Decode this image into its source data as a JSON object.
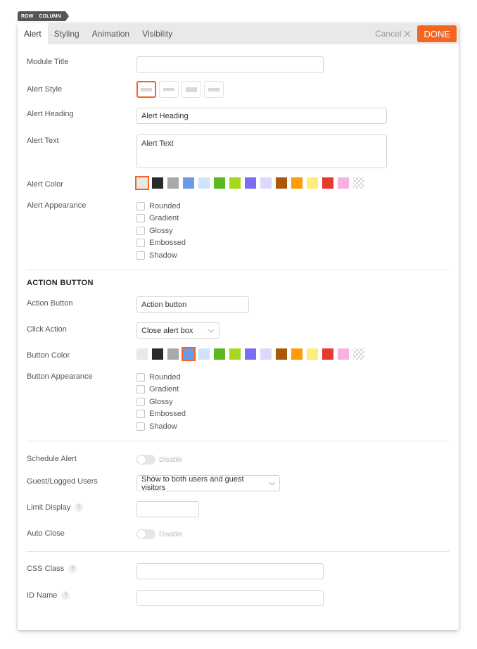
{
  "breadcrumb": [
    "ROW",
    "COLUMN"
  ],
  "tabs": [
    {
      "label": "Alert",
      "active": true
    },
    {
      "label": "Styling",
      "active": false
    },
    {
      "label": "Animation",
      "active": false
    },
    {
      "label": "Visibility",
      "active": false
    }
  ],
  "actions": {
    "cancel_label": "Cancel",
    "done_label": "DONE",
    "accent": "#f26522"
  },
  "alert": {
    "module_title": {
      "label": "Module Title",
      "value": ""
    },
    "alert_style": {
      "label": "Alert Style",
      "options": [
        "style-1",
        "style-2",
        "style-3",
        "style-4"
      ],
      "selected_index": 0
    },
    "alert_heading": {
      "label": "Alert Heading",
      "value": "Alert Heading"
    },
    "alert_text": {
      "label": "Alert Text",
      "value": "Alert Text"
    },
    "alert_color": {
      "label": "Alert Color",
      "selected_index": 0
    },
    "alert_appearance": {
      "label": "Alert Appearance",
      "options": [
        "Rounded",
        "Gradient",
        "Glossy",
        "Embossed",
        "Shadow"
      ]
    }
  },
  "colors": [
    "#e8e8e8",
    "#2a2a2a",
    "#a9a9a9",
    "#6a9be8",
    "#cfe3fb",
    "#5bb81f",
    "#a6d81c",
    "#7b6ef2",
    "#dcd9fb",
    "#a9580c",
    "#ff9c0a",
    "#fded7a",
    "#e8392d",
    "#f7b3dd",
    "transparent"
  ],
  "action_button": {
    "section_title": "ACTION BUTTON",
    "action_button": {
      "label": "Action Button",
      "value": "Action button"
    },
    "click_action": {
      "label": "Click Action",
      "value": "Close alert box"
    },
    "button_color": {
      "label": "Button Color",
      "selected_index": 3
    },
    "button_appearance": {
      "label": "Button Appearance",
      "options": [
        "Rounded",
        "Gradient",
        "Glossy",
        "Embossed",
        "Shadow"
      ]
    }
  },
  "schedule": {
    "schedule_alert": {
      "label": "Schedule Alert",
      "state": "Disable"
    },
    "guest_logged": {
      "label": "Guest/Logged Users",
      "value": "Show to both users and guest visitors"
    },
    "limit_display": {
      "label": "Limit Display",
      "help": "?",
      "value": ""
    },
    "auto_close": {
      "label": "Auto Close",
      "state": "Disable"
    }
  },
  "advanced": {
    "css_class": {
      "label": "CSS Class",
      "help": "?",
      "value": ""
    },
    "id_name": {
      "label": "ID Name",
      "help": "?",
      "value": ""
    }
  }
}
